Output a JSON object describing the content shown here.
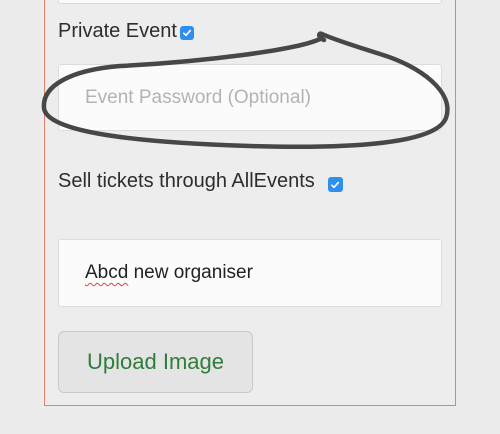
{
  "form": {
    "private_event": {
      "label": "Private Event",
      "checked": true
    },
    "password_field": {
      "placeholder": "Event Password (Optional)",
      "value": ""
    },
    "sell_tickets": {
      "label": "Sell tickets through AllEvents",
      "checked": true
    },
    "organiser_field": {
      "value_misspelled": "Abcd",
      "value_rest": " new organiser"
    },
    "upload_button": {
      "label": "Upload Image"
    }
  },
  "colors": {
    "panel_border": "#e2836a",
    "checkbox": "#2f8ff0",
    "upload_text": "#2e7d3a",
    "annotation_stroke": "#4a4a4a"
  },
  "annotation": {
    "type": "hand-drawn circle around password field"
  }
}
